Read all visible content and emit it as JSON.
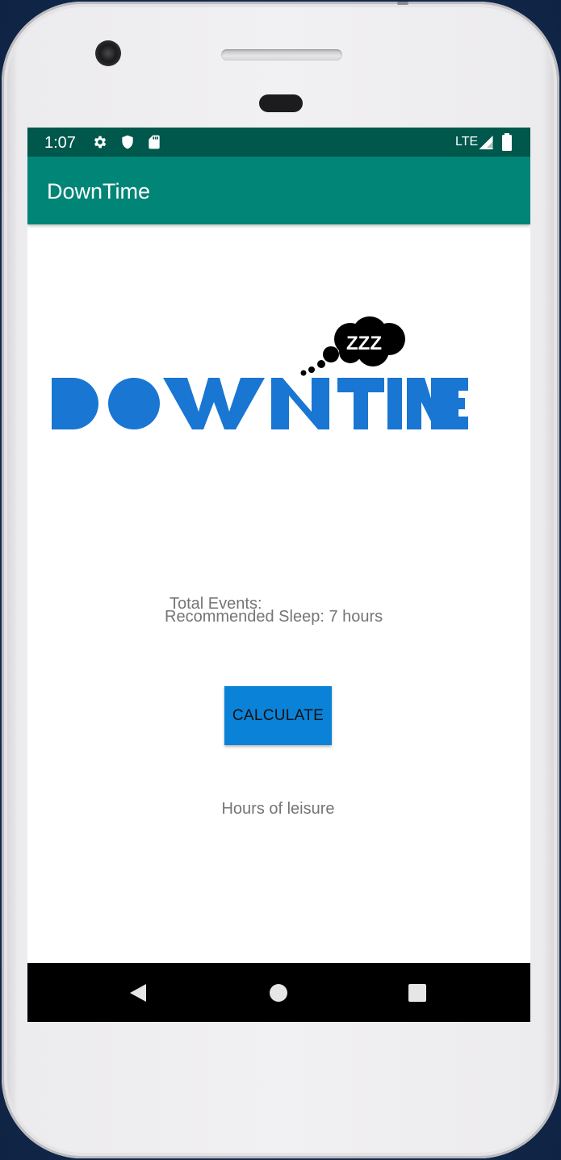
{
  "status_bar": {
    "time": "1:07",
    "network": "LTE",
    "icons": [
      "settings-icon",
      "shield-icon",
      "sd-card-icon",
      "signal-icon",
      "battery-icon"
    ]
  },
  "app_bar": {
    "title": "DownTime"
  },
  "logo": {
    "text": "DOWNTIME",
    "bubble_text": "ZZZ",
    "color": "#1976D2"
  },
  "main": {
    "total_events": "Total Events:",
    "recommended_sleep": "Recommended Sleep: 7 hours",
    "calculate_label": "CALCULATE",
    "leisure_label": "Hours of leisure"
  },
  "nav_bar": {
    "icons": [
      "back-icon",
      "home-icon",
      "recents-icon"
    ]
  },
  "colors": {
    "status_bar": "#00574B",
    "app_bar": "#008577",
    "button": "#0A82D8",
    "text_secondary": "#757575"
  }
}
